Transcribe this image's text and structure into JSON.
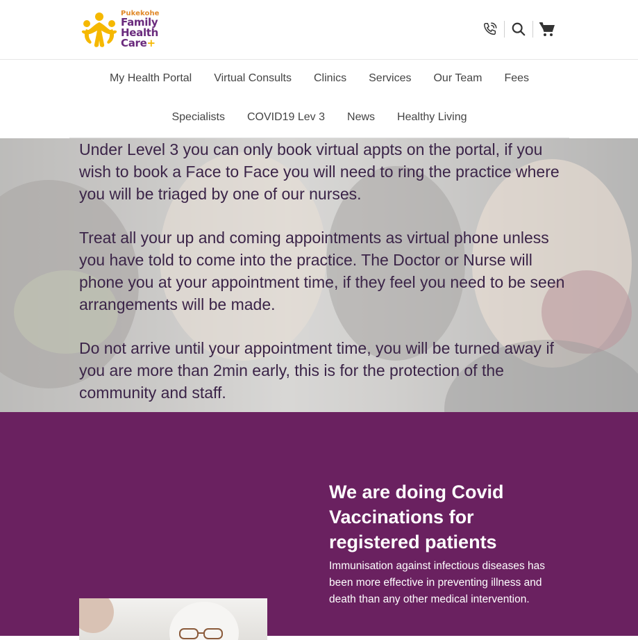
{
  "header": {
    "logo": {
      "line1": "Pukekohe",
      "line2": "Family",
      "line3": "Health",
      "line4": "Care",
      "plus": "+"
    },
    "icons": [
      "phone-icon",
      "search-icon",
      "cart-icon"
    ]
  },
  "nav": {
    "row1": [
      "My Health Portal",
      "Virtual Consults",
      "Clinics",
      "Services",
      "Our Team",
      "Fees"
    ],
    "row2": [
      "Specialists",
      "COVID19 Lev 3",
      "News",
      "Healthy Living"
    ]
  },
  "hero": {
    "paragraphs": [
      "Under Level 3 you can only book virtual appts on the portal, if you wish to book a Face to Face you will need to ring the practice where you will be triaged by one of our nurses.",
      "Treat all your up and coming appointments as virtual phone unless you have told to come into the practice. The Doctor or Nurse will phone you at your appointment time, if they feel you need to be seen arrangements will be made.",
      "Do not arrive until your appointment time, you will be turned away if you are more than 2min early, this is for the protection of the community and staff."
    ]
  },
  "vaccination": {
    "title": "We are doing Covid Vaccinations for registered patients",
    "body": "Immunisation against infectious diseases has been more effective in preventing illness and death than any other medical intervention."
  },
  "colors": {
    "brand_purple": "#6a2160",
    "logo_purple": "#6a2b7d",
    "logo_yellow": "#f5b800",
    "logo_orange": "#e1892a",
    "nav_text": "#444444",
    "hero_text": "#3b2448"
  }
}
